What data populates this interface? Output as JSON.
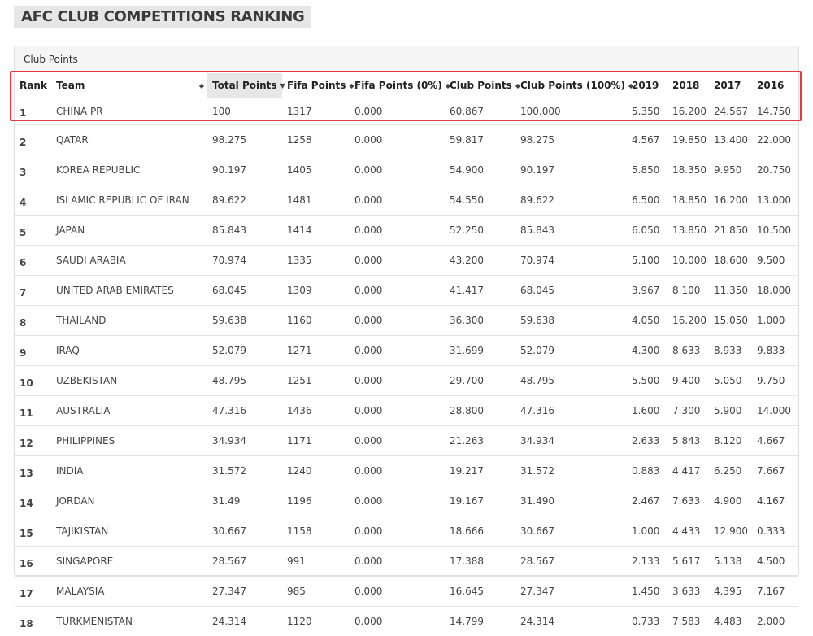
{
  "title": "AFC CLUB COMPETITIONS RANKING",
  "panel_heading": "Club Points",
  "colors": {
    "highlight": "#e8373f",
    "sorted_header": "#e7e7e7"
  },
  "columns": {
    "rank": "Rank",
    "team": "Team",
    "total": "Total Points",
    "fifa": "Fifa Points",
    "fifa0": "Fifa Points (0%)",
    "club": "Club Points",
    "club100": "Club Points (100%)",
    "y2019": "2019",
    "y2018": "2018",
    "y2017": "2017",
    "y2016": "2016"
  },
  "icons": {
    "sort": "sort-both-icon",
    "sorted": "sort-desc-icon"
  },
  "rows": [
    {
      "rank": "1",
      "team": "CHINA PR",
      "total": "100",
      "fifa": "1317",
      "fifa0": "0.000",
      "club": "60.867",
      "club100": "100.000",
      "y2019": "5.350",
      "y2018": "16.200",
      "y2017": "24.567",
      "y2016": "14.750"
    },
    {
      "rank": "2",
      "team": "QATAR",
      "total": "98.275",
      "fifa": "1258",
      "fifa0": "0.000",
      "club": "59.817",
      "club100": "98.275",
      "y2019": "4.567",
      "y2018": "19.850",
      "y2017": "13.400",
      "y2016": "22.000"
    },
    {
      "rank": "3",
      "team": "KOREA REPUBLIC",
      "total": "90.197",
      "fifa": "1405",
      "fifa0": "0.000",
      "club": "54.900",
      "club100": "90.197",
      "y2019": "5.850",
      "y2018": "18.350",
      "y2017": "9.950",
      "y2016": "20.750"
    },
    {
      "rank": "4",
      "team": "ISLAMIC REPUBLIC OF IRAN",
      "total": "89.622",
      "fifa": "1481",
      "fifa0": "0.000",
      "club": "54.550",
      "club100": "89.622",
      "y2019": "6.500",
      "y2018": "18.850",
      "y2017": "16.200",
      "y2016": "13.000"
    },
    {
      "rank": "5",
      "team": "JAPAN",
      "total": "85.843",
      "fifa": "1414",
      "fifa0": "0.000",
      "club": "52.250",
      "club100": "85.843",
      "y2019": "6.050",
      "y2018": "13.850",
      "y2017": "21.850",
      "y2016": "10.500"
    },
    {
      "rank": "6",
      "team": "SAUDI ARABIA",
      "total": "70.974",
      "fifa": "1335",
      "fifa0": "0.000",
      "club": "43.200",
      "club100": "70.974",
      "y2019": "5.100",
      "y2018": "10.000",
      "y2017": "18.600",
      "y2016": "9.500"
    },
    {
      "rank": "7",
      "team": "UNITED ARAB EMIRATES",
      "total": "68.045",
      "fifa": "1309",
      "fifa0": "0.000",
      "club": "41.417",
      "club100": "68.045",
      "y2019": "3.967",
      "y2018": "8.100",
      "y2017": "11.350",
      "y2016": "18.000"
    },
    {
      "rank": "8",
      "team": "THAILAND",
      "total": "59.638",
      "fifa": "1160",
      "fifa0": "0.000",
      "club": "36.300",
      "club100": "59.638",
      "y2019": "4.050",
      "y2018": "16.200",
      "y2017": "15.050",
      "y2016": "1.000"
    },
    {
      "rank": "9",
      "team": "IRAQ",
      "total": "52.079",
      "fifa": "1271",
      "fifa0": "0.000",
      "club": "31.699",
      "club100": "52.079",
      "y2019": "4.300",
      "y2018": "8.633",
      "y2017": "8.933",
      "y2016": "9.833"
    },
    {
      "rank": "10",
      "team": "UZBEKISTAN",
      "total": "48.795",
      "fifa": "1251",
      "fifa0": "0.000",
      "club": "29.700",
      "club100": "48.795",
      "y2019": "5.500",
      "y2018": "9.400",
      "y2017": "5.050",
      "y2016": "9.750"
    },
    {
      "rank": "11",
      "team": "AUSTRALIA",
      "total": "47.316",
      "fifa": "1436",
      "fifa0": "0.000",
      "club": "28.800",
      "club100": "47.316",
      "y2019": "1.600",
      "y2018": "7.300",
      "y2017": "5.900",
      "y2016": "14.000"
    },
    {
      "rank": "12",
      "team": "PHILIPPINES",
      "total": "34.934",
      "fifa": "1171",
      "fifa0": "0.000",
      "club": "21.263",
      "club100": "34.934",
      "y2019": "2.633",
      "y2018": "5.843",
      "y2017": "8.120",
      "y2016": "4.667"
    },
    {
      "rank": "13",
      "team": "INDIA",
      "total": "31.572",
      "fifa": "1240",
      "fifa0": "0.000",
      "club": "19.217",
      "club100": "31.572",
      "y2019": "0.883",
      "y2018": "4.417",
      "y2017": "6.250",
      "y2016": "7.667"
    },
    {
      "rank": "14",
      "team": "JORDAN",
      "total": "31.49",
      "fifa": "1196",
      "fifa0": "0.000",
      "club": "19.167",
      "club100": "31.490",
      "y2019": "2.467",
      "y2018": "7.633",
      "y2017": "4.900",
      "y2016": "4.167"
    },
    {
      "rank": "15",
      "team": "TAJIKISTAN",
      "total": "30.667",
      "fifa": "1158",
      "fifa0": "0.000",
      "club": "18.666",
      "club100": "30.667",
      "y2019": "1.000",
      "y2018": "4.433",
      "y2017": "12.900",
      "y2016": "0.333"
    },
    {
      "rank": "16",
      "team": "SINGAPORE",
      "total": "28.567",
      "fifa": "991",
      "fifa0": "0.000",
      "club": "17.388",
      "club100": "28.567",
      "y2019": "2.133",
      "y2018": "5.617",
      "y2017": "5.138",
      "y2016": "4.500"
    },
    {
      "rank": "17",
      "team": "MALAYSIA",
      "total": "27.347",
      "fifa": "985",
      "fifa0": "0.000",
      "club": "16.645",
      "club100": "27.347",
      "y2019": "1.450",
      "y2018": "3.633",
      "y2017": "4.395",
      "y2016": "7.167"
    },
    {
      "rank": "18",
      "team": "TURKMENISTAN",
      "total": "24.314",
      "fifa": "1120",
      "fifa0": "0.000",
      "club": "14.799",
      "club100": "24.314",
      "y2019": "0.733",
      "y2018": "7.583",
      "y2017": "4.483",
      "y2016": "2.000"
    }
  ]
}
